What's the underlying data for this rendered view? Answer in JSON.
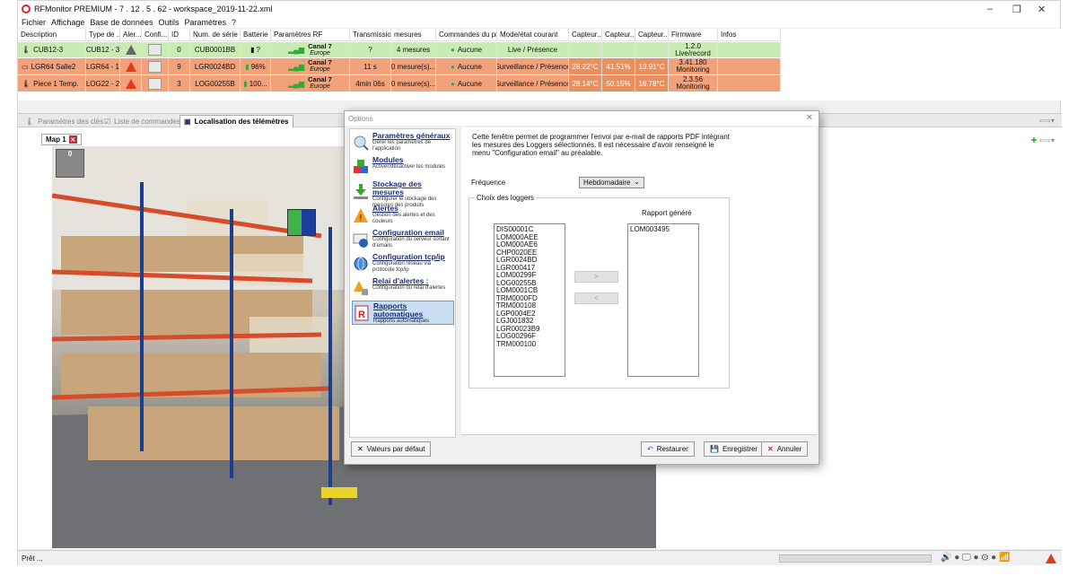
{
  "window": {
    "title": "RFMonitor PREMIUM - 7 . 12 . 5 . 62 - workspace_2019-11-22.xml",
    "controls": {
      "minimize": "–",
      "maximize": "❐",
      "close": "✕"
    }
  },
  "menu": [
    "Fichier",
    "Affichage",
    "Base de données",
    "Outils",
    "Paramètres",
    "?"
  ],
  "table": {
    "headers": [
      "Description",
      "Type de ...",
      "Aler...",
      "Confi...",
      "ID",
      "Num. de série",
      "Batterie",
      "Paramètres RF",
      "Transmissio...",
      "mesures",
      "Commandes du pr...",
      "Mode/état courant",
      "Capteur...",
      "Capteur...",
      "Capteur...",
      "Firmware",
      "Infos"
    ],
    "rows": [
      {
        "desc": "CUB12-3",
        "type": "CUB12 - 3",
        "id": "0",
        "serial": "CUB0001BB",
        "battery": "?",
        "canal": "Canal 7",
        "region": "Europe",
        "transmission": "?",
        "mesures": "4 mesures",
        "commandes": "Aucune",
        "mode": "Live / Présence",
        "c1": "",
        "c2": "",
        "c3": "",
        "firmware": "1.2.0",
        "firmware2": "Live/record",
        "color": "#c9ebb4",
        "alert_color": "#666"
      },
      {
        "desc": "LGR64 Salle2",
        "type": "LGR64 - 1",
        "id": "9",
        "serial": "LGR0024BD",
        "battery": "96%",
        "canal": "Canal 7",
        "region": "Europe",
        "transmission": "11 s",
        "mesures": "0 mesure(s)...",
        "commandes": "Aucune",
        "mode": "Surveillance / Présence",
        "c1": "28.22°C",
        "c2": "41.51%",
        "c3": "13.91°C",
        "firmware": "3.41.180",
        "firmware2": "Monitoring",
        "color": "#f1a27a",
        "alert_color": "#e23a1b"
      },
      {
        "desc": "Piece 1 Temp.",
        "type": "LOG22 - 2",
        "id": "3",
        "serial": "LOG00255B",
        "battery": "100...",
        "canal": "Canal 7",
        "region": "Europe",
        "transmission": "4min 06s",
        "mesures": "0 mesure(s)...",
        "commandes": "Aucune",
        "mode": "Surveillance / Présence",
        "c1": "28.14°C",
        "c2": "50.15%",
        "c3": "16.78°C",
        "firmware": "2.3.56",
        "firmware2": "Monitoring",
        "color": "#f1a27a",
        "alert_color": "#e23a1b"
      }
    ]
  },
  "tabs": [
    {
      "label": "Paramètres des clés"
    },
    {
      "label": "Liste de commandes"
    },
    {
      "label": "Localisation des télémètres"
    }
  ],
  "map": {
    "tab_label": "Map 1",
    "marker_label": "0"
  },
  "status": {
    "text": "Prêt ..."
  },
  "dialog": {
    "title": "Options",
    "nav": [
      {
        "title": "Paramètres généraux",
        "sub": "Gérer les paramètres de l'application"
      },
      {
        "title": "Modules",
        "sub": "Activer/désactiver les modules"
      },
      {
        "title": "Stockage des mesures",
        "sub": "Configurer le stockage des mesures des produits"
      },
      {
        "title": "Alertes",
        "sub": "Gestion des alertes et des couleurs"
      },
      {
        "title": "Configuration email",
        "sub": "Configuration du serveur sortant d'emails"
      },
      {
        "title": "Configuration tcp/ip",
        "sub": "Configuration réseau via protocole tcp/ip"
      },
      {
        "title": "Relai d'alertes :",
        "sub": "Configuration du relai d'alertes"
      },
      {
        "title": "Rapports automatiques",
        "sub": "Rapports automatiques"
      }
    ],
    "description": "Cette fenêtre permet de programmer l'envoi par e-mail de rapports PDF intégrant les mesures des Loggers sélectionnés. Il est nécessaire d'avoir renseigné le menu \"Configuration email\" au préalable.",
    "frequency_label": "Fréquence",
    "frequency_value": "Hebdomadaire",
    "group_label": "Choix des loggers",
    "report_label": "Rapport généré",
    "available_loggers": [
      "DIS00001C",
      "LOM000AEE",
      "LOM000AE6",
      "CHP0020EE",
      "LGR0024BD",
      "LGR000417",
      "LOM00299F",
      "LOG00255B",
      "LOM0001CB",
      "TRM0000FD",
      "TRM000108",
      "LGP0004E2",
      "LGJ001832",
      "LGR00023B9",
      "LOG00296F",
      "TRM000100"
    ],
    "selected_loggers": [
      "LOM003495"
    ],
    "move_right": ">",
    "move_left": "<",
    "buttons": {
      "defaults": "Valeurs par défaut",
      "restore": "Restaurer",
      "save": "Enregistrer",
      "cancel": "Annuler"
    }
  }
}
